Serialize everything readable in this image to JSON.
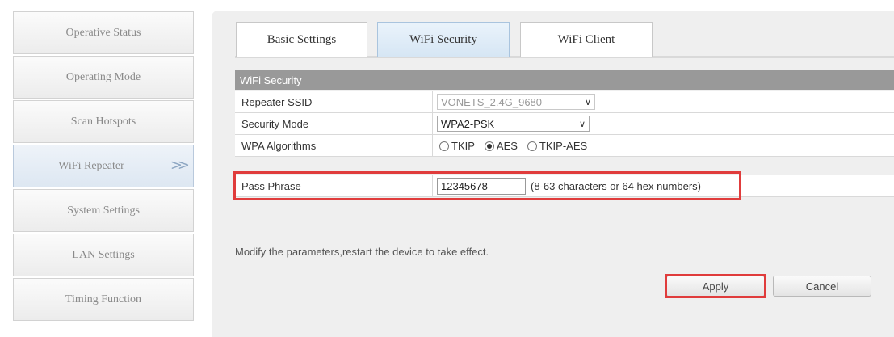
{
  "sidebar": {
    "items": [
      {
        "label": "Operative Status"
      },
      {
        "label": "Operating Mode"
      },
      {
        "label": "Scan Hotspots"
      },
      {
        "label": "WiFi Repeater",
        "active": true,
        "arrow": ">>"
      },
      {
        "label": "System Settings"
      },
      {
        "label": "LAN Settings"
      },
      {
        "label": "Timing Function"
      }
    ]
  },
  "tabs": [
    {
      "label": "Basic Settings"
    },
    {
      "label": "WiFi Security",
      "active": true
    },
    {
      "label": "WiFi Client"
    }
  ],
  "section": {
    "title": "WiFi Security",
    "ssid": {
      "label": "Repeater SSID",
      "value": "VONETS_2.4G_9680"
    },
    "security_mode": {
      "label": "Security Mode",
      "value": "WPA2-PSK"
    },
    "algorithms": {
      "label": "WPA Algorithms",
      "options": [
        "TKIP",
        "AES",
        "TKIP-AES"
      ],
      "selected": "AES"
    },
    "pass_phrase": {
      "label": "Pass Phrase",
      "value": "12345678",
      "hint": "(8-63 characters or 64 hex numbers)"
    }
  },
  "note": "Modify the parameters,restart the device to take effect.",
  "buttons": {
    "apply": "Apply",
    "cancel": "Cancel"
  },
  "colors": {
    "highlight": "#e03c3c",
    "section_header": "#999999",
    "active_nav": "#dde7f2"
  }
}
